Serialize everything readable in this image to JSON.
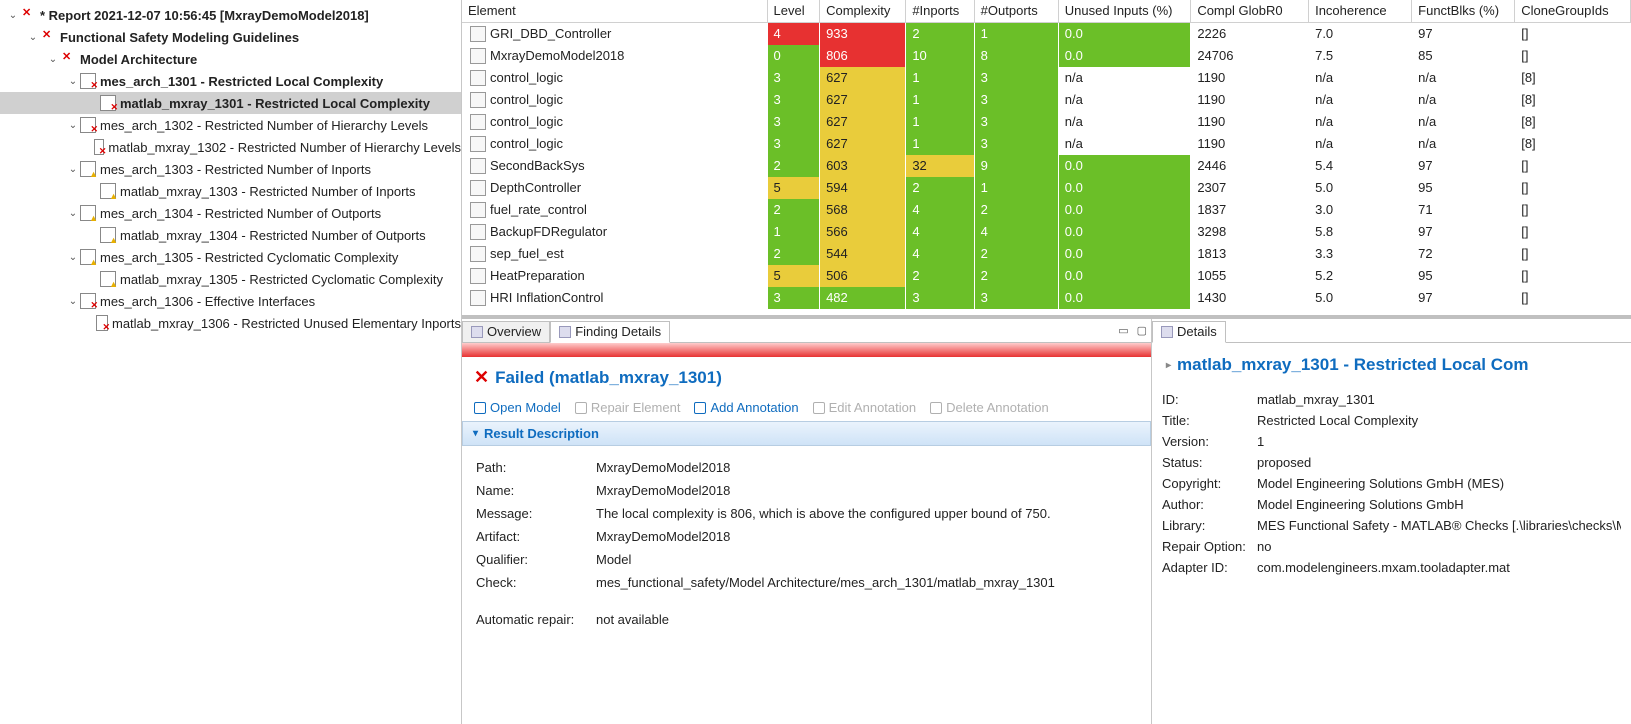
{
  "tree": [
    {
      "depth": 0,
      "tw": "⌄",
      "icon": "rx",
      "bold": true,
      "label": "* Report 2021-12-07 10:56:45 [MxrayDemoModel2018]",
      "sel": false
    },
    {
      "depth": 1,
      "tw": "⌄",
      "icon": "rx",
      "bold": true,
      "label": "Functional Safety Modeling Guidelines",
      "sel": false
    },
    {
      "depth": 2,
      "tw": "⌄",
      "icon": "rx",
      "bold": true,
      "label": "Model Architecture",
      "sel": false
    },
    {
      "depth": 3,
      "tw": "⌄",
      "icon": "rd",
      "bold": true,
      "label": "mes_arch_1301 - Restricted Local Complexity",
      "sel": false
    },
    {
      "depth": 4,
      "tw": "",
      "icon": "rd",
      "bold": true,
      "label": "matlab_mxray_1301 - Restricted Local Complexity",
      "sel": true
    },
    {
      "depth": 3,
      "tw": "⌄",
      "icon": "rd",
      "bold": false,
      "label": "mes_arch_1302 - Restricted Number of Hierarchy Levels",
      "sel": false
    },
    {
      "depth": 4,
      "tw": "",
      "icon": "rd",
      "bold": false,
      "label": "matlab_mxray_1302 - Restricted Number of Hierarchy Levels",
      "sel": false
    },
    {
      "depth": 3,
      "tw": "⌄",
      "icon": "ye",
      "bold": false,
      "label": "mes_arch_1303 - Restricted Number of Inports",
      "sel": false
    },
    {
      "depth": 4,
      "tw": "",
      "icon": "ye",
      "bold": false,
      "label": "matlab_mxray_1303 - Restricted Number of Inports",
      "sel": false
    },
    {
      "depth": 3,
      "tw": "⌄",
      "icon": "ye",
      "bold": false,
      "label": "mes_arch_1304 - Restricted Number of Outports",
      "sel": false
    },
    {
      "depth": 4,
      "tw": "",
      "icon": "ye",
      "bold": false,
      "label": "matlab_mxray_1304 - Restricted Number of Outports",
      "sel": false
    },
    {
      "depth": 3,
      "tw": "⌄",
      "icon": "ye",
      "bold": false,
      "label": "mes_arch_1305 - Restricted Cyclomatic Complexity",
      "sel": false
    },
    {
      "depth": 4,
      "tw": "",
      "icon": "ye",
      "bold": false,
      "label": "matlab_mxray_1305 - Restricted Cyclomatic Complexity",
      "sel": false
    },
    {
      "depth": 3,
      "tw": "⌄",
      "icon": "rd",
      "bold": false,
      "label": "mes_arch_1306 - Effective Interfaces",
      "sel": false
    },
    {
      "depth": 4,
      "tw": "",
      "icon": "rd",
      "bold": false,
      "label": "matlab_mxray_1306 - Restricted Unused Elementary Inports",
      "sel": false
    }
  ],
  "table": {
    "columns": [
      "Element",
      "Level",
      "Complexity",
      "#Inports",
      "#Outports",
      "Unused Inputs (%)",
      "Compl GlobR0",
      "Incoherence",
      "FunctBlks (%)",
      "CloneGroupIds"
    ],
    "widths": [
      290,
      50,
      82,
      65,
      80,
      126,
      112,
      98,
      98,
      110
    ],
    "rows": [
      {
        "el": "GRI_DBD_Controller",
        "level": "4",
        "lc": "red",
        "complexity": "933",
        "cc": "red",
        "in": "2",
        "ic": "green",
        "out": "1",
        "oc": "green",
        "unused": "0.0",
        "uc": "green",
        "g": "2226",
        "inc": "7.0",
        "fb": "97",
        "cg": "[]"
      },
      {
        "el": "MxrayDemoModel2018",
        "level": "0",
        "lc": "green",
        "complexity": "806",
        "cc": "red",
        "in": "10",
        "ic": "green",
        "out": "8",
        "oc": "green",
        "unused": "0.0",
        "uc": "green",
        "g": "24706",
        "inc": "7.5",
        "fb": "85",
        "cg": "[]"
      },
      {
        "el": "control_logic",
        "level": "3",
        "lc": "green",
        "complexity": "627",
        "cc": "yellow",
        "in": "1",
        "ic": "green",
        "out": "3",
        "oc": "green",
        "unused": "n/a",
        "uc": "",
        "g": "1190",
        "inc": "n/a",
        "fb": "n/a",
        "cg": "[8]"
      },
      {
        "el": "control_logic",
        "level": "3",
        "lc": "green",
        "complexity": "627",
        "cc": "yellow",
        "in": "1",
        "ic": "green",
        "out": "3",
        "oc": "green",
        "unused": "n/a",
        "uc": "",
        "g": "1190",
        "inc": "n/a",
        "fb": "n/a",
        "cg": "[8]"
      },
      {
        "el": "control_logic",
        "level": "3",
        "lc": "green",
        "complexity": "627",
        "cc": "yellow",
        "in": "1",
        "ic": "green",
        "out": "3",
        "oc": "green",
        "unused": "n/a",
        "uc": "",
        "g": "1190",
        "inc": "n/a",
        "fb": "n/a",
        "cg": "[8]"
      },
      {
        "el": "control_logic",
        "level": "3",
        "lc": "green",
        "complexity": "627",
        "cc": "yellow",
        "in": "1",
        "ic": "green",
        "out": "3",
        "oc": "green",
        "unused": "n/a",
        "uc": "",
        "g": "1190",
        "inc": "n/a",
        "fb": "n/a",
        "cg": "[8]"
      },
      {
        "el": "SecondBackSys",
        "level": "2",
        "lc": "green",
        "complexity": "603",
        "cc": "yellow",
        "in": "32",
        "ic": "yellow",
        "out": "9",
        "oc": "green",
        "unused": "0.0",
        "uc": "green",
        "g": "2446",
        "inc": "5.4",
        "fb": "97",
        "cg": "[]"
      },
      {
        "el": "DepthController",
        "level": "5",
        "lc": "yellow",
        "complexity": "594",
        "cc": "yellow",
        "in": "2",
        "ic": "green",
        "out": "1",
        "oc": "green",
        "unused": "0.0",
        "uc": "green",
        "g": "2307",
        "inc": "5.0",
        "fb": "95",
        "cg": "[]"
      },
      {
        "el": "fuel_rate_control",
        "level": "2",
        "lc": "green",
        "complexity": "568",
        "cc": "yellow",
        "in": "4",
        "ic": "green",
        "out": "2",
        "oc": "green",
        "unused": "0.0",
        "uc": "green",
        "g": "1837",
        "inc": "3.0",
        "fb": "71",
        "cg": "[]"
      },
      {
        "el": "BackupFDRegulator",
        "level": "1",
        "lc": "green",
        "complexity": "566",
        "cc": "yellow",
        "in": "4",
        "ic": "green",
        "out": "4",
        "oc": "green",
        "unused": "0.0",
        "uc": "green",
        "g": "3298",
        "inc": "5.8",
        "fb": "97",
        "cg": "[]"
      },
      {
        "el": "sep_fuel_est",
        "level": "2",
        "lc": "green",
        "complexity": "544",
        "cc": "yellow",
        "in": "4",
        "ic": "green",
        "out": "2",
        "oc": "green",
        "unused": "0.0",
        "uc": "green",
        "g": "1813",
        "inc": "3.3",
        "fb": "72",
        "cg": "[]"
      },
      {
        "el": "HeatPreparation",
        "level": "5",
        "lc": "yellow",
        "complexity": "506",
        "cc": "yellow",
        "in": "2",
        "ic": "green",
        "out": "2",
        "oc": "green",
        "unused": "0.0",
        "uc": "green",
        "g": "1055",
        "inc": "5.2",
        "fb": "95",
        "cg": "[]"
      },
      {
        "el": "HRI InflationControl",
        "level": "3",
        "lc": "green",
        "complexity": "482",
        "cc": "green",
        "in": "3",
        "ic": "green",
        "out": "3",
        "oc": "green",
        "unused": "0.0",
        "uc": "green",
        "g": "1430",
        "inc": "5.0",
        "fb": "97",
        "cg": "[]"
      }
    ]
  },
  "tabs_left": {
    "overview": "Overview",
    "finding": "Finding Details"
  },
  "tabs_right": {
    "details": "Details"
  },
  "fail_header": "Failed (matlab_mxray_1301)",
  "toolbar": {
    "open": "Open Model",
    "repair": "Repair Element",
    "addann": "Add Annotation",
    "editann": "Edit Annotation",
    "delann": "Delete Annotation"
  },
  "section": "Result Description",
  "result": {
    "Path": "MxrayDemoModel2018",
    "Name": "MxrayDemoModel2018",
    "Message": "The local complexity is 806, which is above the configured upper bound of 750.",
    "Artifact": "MxrayDemoModel2018",
    "Qualifier": "Model",
    "Check": "mes_functional_safety/Model Architecture/mes_arch_1301/matlab_mxray_1301",
    "Automatic repair": "not available"
  },
  "detail_title": "matlab_mxray_1301 - Restricted Local Com",
  "details": {
    "ID": "matlab_mxray_1301",
    "Title": "Restricted Local Complexity",
    "Version": "1",
    "Status": "proposed",
    "Copyright": "Model Engineering Solutions GmbH (MES)",
    "Author": "Model Engineering Solutions GmbH",
    "Library": "MES Functional Safety - MATLAB® Checks [.\\libraries\\checks\\MATLAB_Functional_Safety",
    "Repair Option": "no",
    "Adapter ID": "com.modelengineers.mxam.tooladapter.mat"
  },
  "labels": {
    "path": "Path:",
    "name": "Name:",
    "message": "Message:",
    "artifact": "Artifact:",
    "qualifier": "Qualifier:",
    "check": "Check:",
    "autorepair": "Automatic repair:",
    "id": "ID:",
    "title": "Title:",
    "version": "Version:",
    "status": "Status:",
    "copyright": "Copyright:",
    "author": "Author:",
    "library": "Library:",
    "repairopt": "Repair Option:",
    "adapterid": "Adapter ID:"
  }
}
